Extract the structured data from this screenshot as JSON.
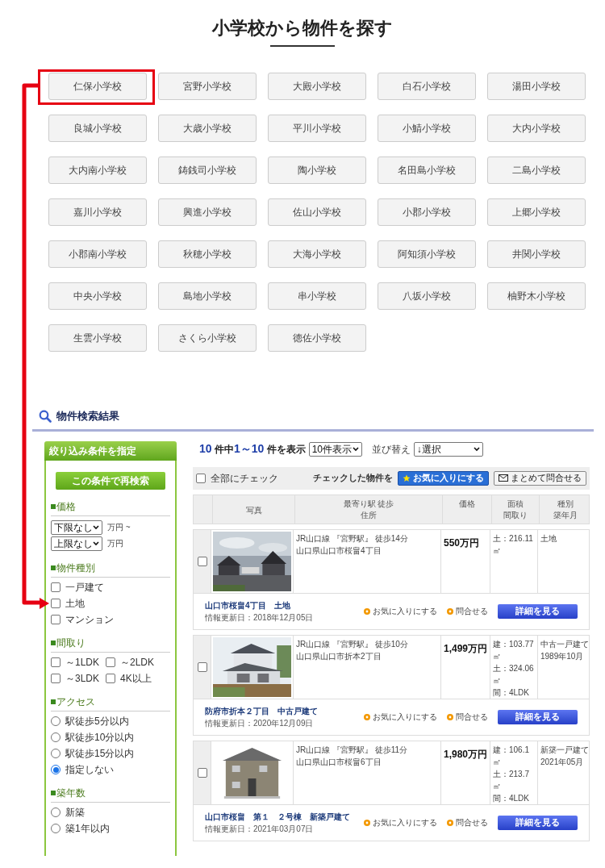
{
  "title": "小学校から物件を探す",
  "schools": [
    {
      "name": "仁保小学校",
      "highlighted": true
    },
    {
      "name": "宮野小学校",
      "highlighted": false
    },
    {
      "name": "大殿小学校",
      "highlighted": false
    },
    {
      "name": "白石小学校",
      "highlighted": false
    },
    {
      "name": "湯田小学校",
      "highlighted": false
    },
    {
      "name": "良城小学校",
      "highlighted": false
    },
    {
      "name": "大歳小学校",
      "highlighted": false
    },
    {
      "name": "平川小学校",
      "highlighted": false
    },
    {
      "name": "小鯖小学校",
      "highlighted": false
    },
    {
      "name": "大内小学校",
      "highlighted": false
    },
    {
      "name": "大内南小学校",
      "highlighted": false
    },
    {
      "name": "鋳銭司小学校",
      "highlighted": false
    },
    {
      "name": "陶小学校",
      "highlighted": false
    },
    {
      "name": "名田島小学校",
      "highlighted": false
    },
    {
      "name": "二島小学校",
      "highlighted": false
    },
    {
      "name": "嘉川小学校",
      "highlighted": false
    },
    {
      "name": "興進小学校",
      "highlighted": false
    },
    {
      "name": "佐山小学校",
      "highlighted": false
    },
    {
      "name": "小郡小学校",
      "highlighted": false
    },
    {
      "name": "上郷小学校",
      "highlighted": false
    },
    {
      "name": "小郡南小学校",
      "highlighted": false
    },
    {
      "name": "秋穂小学校",
      "highlighted": false
    },
    {
      "name": "大海小学校",
      "highlighted": false
    },
    {
      "name": "阿知須小学校",
      "highlighted": false
    },
    {
      "name": "井関小学校",
      "highlighted": false
    },
    {
      "name": "中央小学校",
      "highlighted": false
    },
    {
      "name": "島地小学校",
      "highlighted": false
    },
    {
      "name": "串小学校",
      "highlighted": false
    },
    {
      "name": "八坂小学校",
      "highlighted": false
    },
    {
      "name": "柚野木小学校",
      "highlighted": false
    },
    {
      "name": "生雲小学校",
      "highlighted": false
    },
    {
      "name": "さくら小学校",
      "highlighted": false
    },
    {
      "name": "徳佐小学校",
      "highlighted": false
    }
  ],
  "results": {
    "heading": "物件検索結果",
    "sidebar": {
      "header": "絞り込み条件を指定",
      "button": "この条件で再検索",
      "sections": [
        {
          "kind": "selects",
          "label": "価格",
          "items": [
            {
              "value": "下限なし",
              "unit": "万円 ~"
            },
            {
              "value": "上限なし",
              "unit": "万円"
            }
          ]
        },
        {
          "kind": "checkboxes",
          "label": "物件種別",
          "items": [
            {
              "label": "一戸建て",
              "checked": false,
              "pointed": false
            },
            {
              "label": "土地",
              "checked": false,
              "pointed": true
            },
            {
              "label": "マンション",
              "checked": false,
              "pointed": false
            }
          ]
        },
        {
          "kind": "checkbox-grid",
          "label": "間取り",
          "items": [
            {
              "label": "～1LDK",
              "checked": false,
              "pointed": false
            },
            {
              "label": "～2LDK",
              "checked": false,
              "pointed": false
            },
            {
              "label": "～3LDK",
              "checked": false,
              "pointed": false
            },
            {
              "label": "4K以上",
              "checked": false,
              "pointed": false
            }
          ]
        },
        {
          "kind": "radios",
          "label": "アクセス",
          "items": [
            {
              "label": "駅徒歩5分以内",
              "selected": false
            },
            {
              "label": "駅徒歩10分以内",
              "selected": false
            },
            {
              "label": "駅徒歩15分以内",
              "selected": false
            },
            {
              "label": "指定しない",
              "selected": true
            }
          ]
        },
        {
          "kind": "radios",
          "label": "築年数",
          "items": [
            {
              "label": "新築",
              "selected": false
            },
            {
              "label": "築1年以内",
              "selected": false
            }
          ]
        }
      ]
    },
    "summary": {
      "total": "10",
      "of": "件中",
      "range": "1～10",
      "shown": "件を表示",
      "per_page": "10件表示",
      "sort_label": "並び替え",
      "sort": "↓選択"
    },
    "toolbar": {
      "check_all": "全部にチェック",
      "check_all_checked": false,
      "label": "チェックした物件を",
      "favorite": "お気に入りにする",
      "inquiry": "まとめて問合せる"
    },
    "columns": [
      [
        "写真"
      ],
      [
        "最寄り駅 徒歩",
        "住所"
      ],
      [
        "価格"
      ],
      [
        "面積",
        "間取り"
      ],
      [
        "種別",
        "築年月"
      ]
    ],
    "listings": [
      {
        "checked": false,
        "station": "JR山口線 『宮野駅』 徒歩14分",
        "address": "山口県山口市桜畠4丁目",
        "price": "550万円",
        "area": [
          "土：216.11㎡"
        ],
        "type": [
          "土地"
        ],
        "title": "山口市桜畠4丁目　土地",
        "updated": "情報更新日：2018年12月05日",
        "favorite": "お気に入りにする",
        "inquiry": "問合せる",
        "detail": "詳細を見る"
      },
      {
        "checked": false,
        "station": "JR山口線 『宮野駅』 徒歩10分",
        "address": "山口県山口市折本2丁目",
        "price": "1,499万円",
        "area": [
          "建：103.77㎡",
          "土：324.06㎡",
          "間：4LDK"
        ],
        "type": [
          "中古一戸建て",
          "1989年10月"
        ],
        "title": "防府市折本２丁目　中古戸建て",
        "updated": "情報更新日：2020年12月09日",
        "favorite": "お気に入りにする",
        "inquiry": "問合せる",
        "detail": "詳細を見る"
      },
      {
        "checked": false,
        "station": "JR山口線 『宮野駅』 徒歩11分",
        "address": "山口県山口市桜畠6丁目",
        "price": "1,980万円",
        "area": [
          "建：106.1㎡",
          "土：213.7㎡",
          "間：4LDK"
        ],
        "type": [
          "新築一戸建て",
          "2021年05月"
        ],
        "title": "山口市桜畠　第１　２号棟　新築戸建て",
        "updated": "情報更新日：2021年03月07日",
        "favorite": "お気に入りにする",
        "inquiry": "問合せる",
        "detail": "詳細を見る"
      }
    ]
  }
}
